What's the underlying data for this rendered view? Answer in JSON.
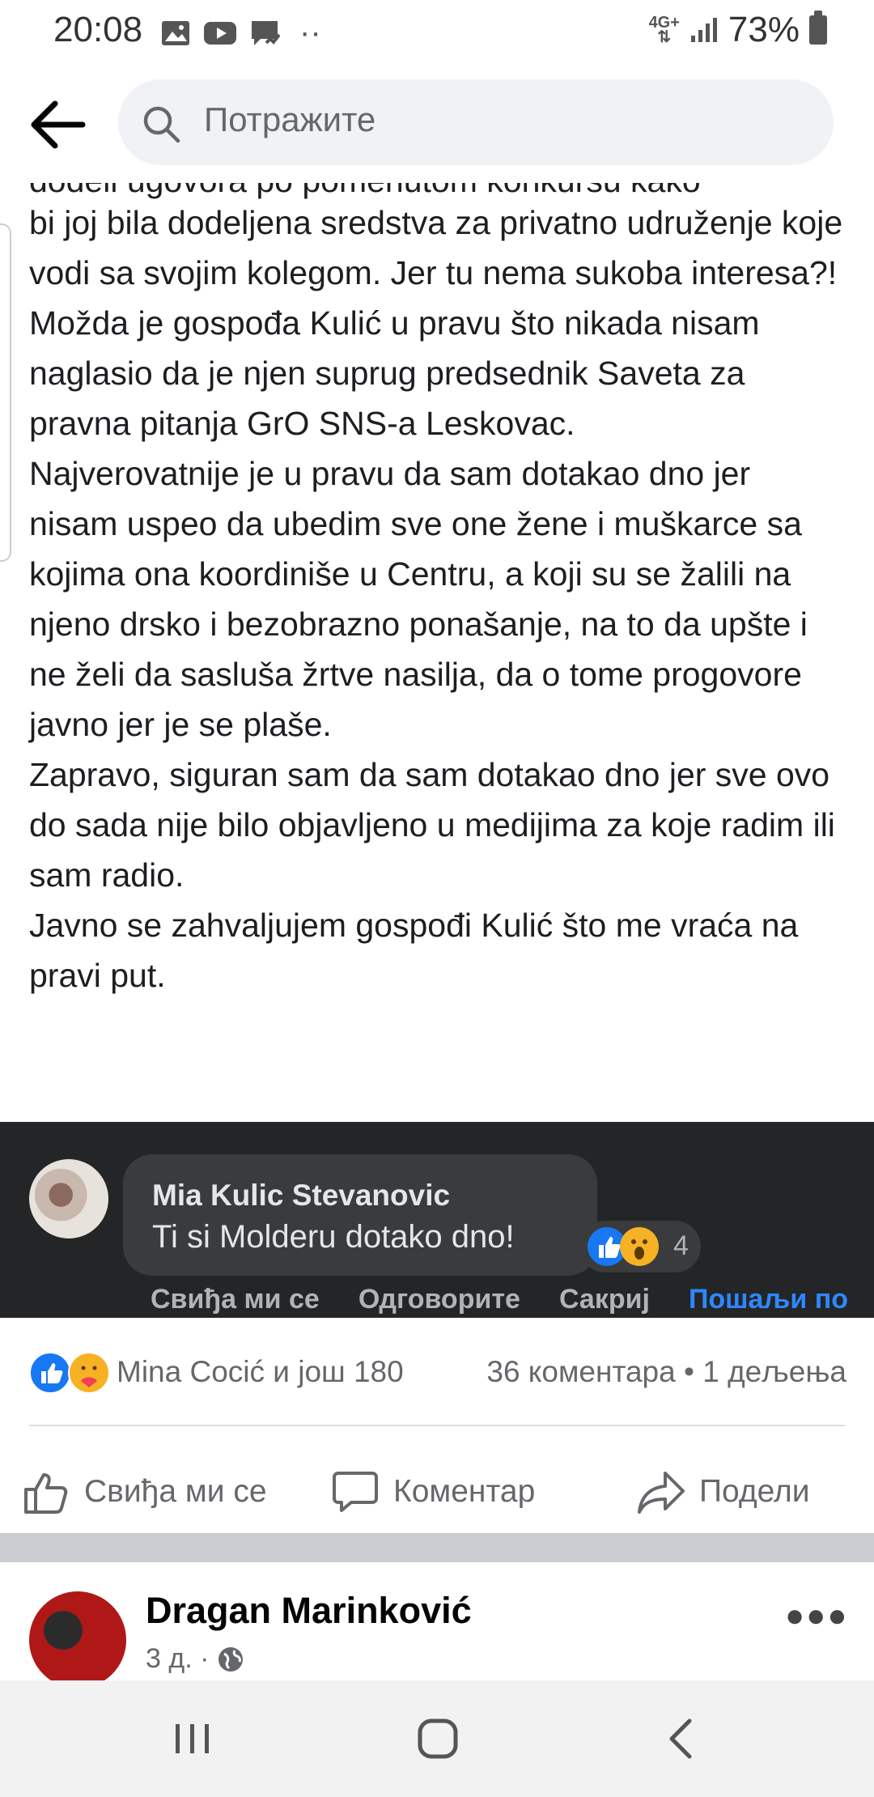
{
  "status_bar": {
    "time": "20:08",
    "dots": "··",
    "network": "4G+",
    "battery": "73%"
  },
  "header": {
    "search_placeholder": "Потражите"
  },
  "post": {
    "cut_line": "dodeli ugovora po pomenutom konkursu kako",
    "paragraphs": [
      "bi joj bila dodeljena sredstva za privatno udruženje koje vodi sa svojim kolegom. Jer tu nema sukoba interesa?!",
      "Možda je gospođa Kulić u pravu što nikada nisam naglasio da je njen suprug predsednik Saveta za pravna pitanja GrO SNS-a Leskovac.",
      "Najverovatnije je u pravu da sam dotakao dno jer nisam uspeo da ubedim sve one žene i muškarce sa kojima ona koordiniše u Centru, a koji su se žalili na njeno drsko i bezobrazno ponašanje, na to da upšte i ne želi da sasluša žrtve nasilja, da o tome progovore javno jer je se plaše.",
      "Zapravo, siguran sam da sam dotakao dno jer sve ovo do sada nije bilo objavljeno u medijima za koje radim ili sam radio.",
      "Javno se zahvaljujem gospođi Kulić što me vraća na pravi put."
    ]
  },
  "embedded_comment": {
    "author": "Mia Kulic Stevanovic",
    "text": "Ti si Molderu dotako dno!",
    "reaction_count": "4",
    "actions": [
      "Свиђа ми се",
      "Одговорите",
      "Сакриј",
      "Пошаљи по"
    ]
  },
  "reactions": {
    "names": "Mina Cocić и још 180",
    "counts": "36 коментара • 1 дељења"
  },
  "actions": {
    "like": "Свиђа ми се",
    "comment": "Коментар",
    "share": "Подели"
  },
  "next_post": {
    "author": "Dragan Marinković",
    "time": "3 д. ·"
  }
}
